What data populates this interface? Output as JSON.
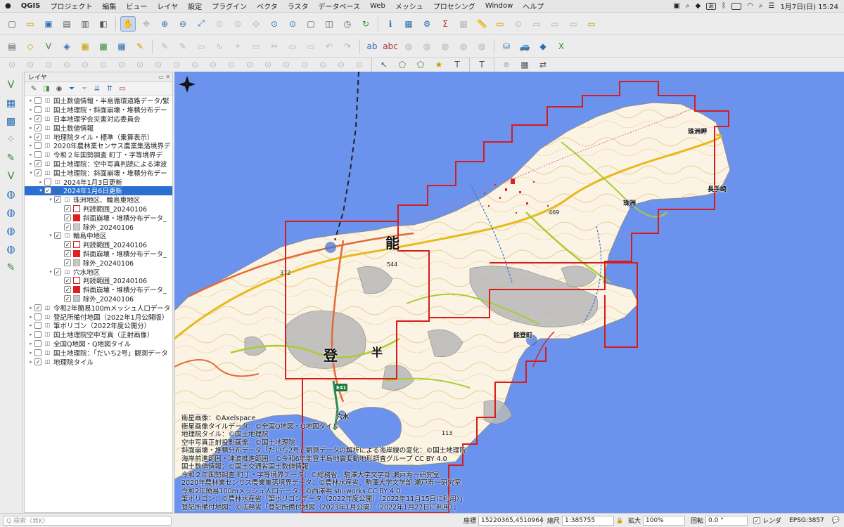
{
  "menubar": {
    "app": "QGIS",
    "items": [
      "プロジェクト",
      "編集",
      "ビュー",
      "レイヤ",
      "設定",
      "プラグイン",
      "ベクタ",
      "ラスタ",
      "データベース",
      "Web",
      "メッシュ",
      "プロセシング",
      "Window",
      "ヘルプ"
    ],
    "ime": "あ",
    "clock": "1月7日(日)  15:24"
  },
  "layers_panel": {
    "title": "レイヤ",
    "rows": [
      {
        "indent": 0,
        "arrow": "▸",
        "checked": false,
        "label": "国土数値情報・半島循環道路データ/緊"
      },
      {
        "indent": 0,
        "arrow": "▸",
        "checked": false,
        "label": "国土地理院・斜面崩壊・堆積分布デー"
      },
      {
        "indent": 0,
        "arrow": "▸",
        "checked": true,
        "label": "日本地理学会災害対応委員会"
      },
      {
        "indent": 0,
        "arrow": "▸",
        "checked": true,
        "label": "国土数値情報"
      },
      {
        "indent": 0,
        "arrow": "▸",
        "checked": true,
        "label": "地理院タイル・標準（乗算表示）"
      },
      {
        "indent": 0,
        "arrow": "▸",
        "checked": false,
        "label": "2020年農林業センサス農業集落境界デ"
      },
      {
        "indent": 0,
        "arrow": "▸",
        "checked": false,
        "label": "令和２年国勢調査 町丁・字等境界デ"
      },
      {
        "indent": 0,
        "arrow": "▸",
        "checked": true,
        "label": "国土地理院：空中写真判読による津波"
      },
      {
        "indent": 0,
        "arrow": "▾",
        "checked": true,
        "label": "国土地理院：斜面崩壊・堆積分布デー"
      },
      {
        "indent": 1,
        "arrow": "▸",
        "checked": false,
        "label": "2024年1月3日更新"
      },
      {
        "indent": 1,
        "arrow": "▾",
        "checked": true,
        "label": "2024年1月6日更新",
        "selected": true
      },
      {
        "indent": 2,
        "arrow": "▾",
        "checked": true,
        "label": "珠洲地区、輪島東地区"
      },
      {
        "indent": 3,
        "arrow": "",
        "checked": true,
        "label": "判読範囲_20240106",
        "swatch": "#ffffff",
        "swborder": "#cc2222"
      },
      {
        "indent": 3,
        "arrow": "",
        "checked": true,
        "label": "斜面崩壊・堆積分布データ_",
        "swatch": "#e02020",
        "swborder": "#e02020"
      },
      {
        "indent": 3,
        "arrow": "",
        "checked": true,
        "label": "除外_20240106",
        "swatch": "#c8c8c8",
        "swborder": "#aaaaaa"
      },
      {
        "indent": 2,
        "arrow": "▾",
        "checked": true,
        "label": "輪島中地区"
      },
      {
        "indent": 3,
        "arrow": "",
        "checked": true,
        "label": "判読範囲_20240106",
        "swatch": "#ffffff",
        "swborder": "#cc2222"
      },
      {
        "indent": 3,
        "arrow": "",
        "checked": true,
        "label": "斜面崩壊・堆積分布データ_",
        "swatch": "#e02020",
        "swborder": "#e02020"
      },
      {
        "indent": 3,
        "arrow": "",
        "checked": true,
        "label": "除外_20240106",
        "swatch": "#c8c8c8",
        "swborder": "#aaaaaa"
      },
      {
        "indent": 2,
        "arrow": "▾",
        "checked": true,
        "label": "穴水地区"
      },
      {
        "indent": 3,
        "arrow": "",
        "checked": true,
        "label": "判読範囲_20240106",
        "swatch": "#ffffff",
        "swborder": "#cc2222"
      },
      {
        "indent": 3,
        "arrow": "",
        "checked": true,
        "label": "斜面崩壊・堆積分布データ_",
        "swatch": "#e02020",
        "swborder": "#e02020"
      },
      {
        "indent": 3,
        "arrow": "",
        "checked": true,
        "label": "除外_20240106",
        "swatch": "#c8c8c8",
        "swborder": "#aaaaaa"
      },
      {
        "indent": 0,
        "arrow": "▸",
        "checked": true,
        "label": "令和2年簡易100mメッシュ人口データ"
      },
      {
        "indent": 0,
        "arrow": "▸",
        "checked": false,
        "label": "登記所備付地図（2022年1月公開版）"
      },
      {
        "indent": 0,
        "arrow": "▸",
        "checked": false,
        "label": "筆ポリゴン（2022年度公開分）"
      },
      {
        "indent": 0,
        "arrow": "▸",
        "checked": false,
        "label": "国土地理院空中写真（正射画像）"
      },
      {
        "indent": 0,
        "arrow": "▸",
        "checked": false,
        "label": "全国Q地図・Q地図タイル"
      },
      {
        "indent": 0,
        "arrow": "▸",
        "checked": false,
        "label": "国土地理院：「だいち2号」観測データ"
      },
      {
        "indent": 0,
        "arrow": "▸",
        "checked": true,
        "label": "地理院タイル"
      }
    ]
  },
  "map": {
    "place_labels": {
      "suzu_misaki": "珠洲岬",
      "nagate_misaki": "長手崎",
      "suzu": "珠洲",
      "noto_town": "能登町",
      "anamizu": "穴水"
    },
    "peninsula_chars": {
      "no": "能",
      "to": "登",
      "sub": "半"
    },
    "spot_heights": {
      "h469": "469",
      "h544": "544",
      "h372": "372",
      "h113": "113"
    },
    "route": "E41",
    "attribution": [
      "衛星画像：©Axelspace",
      "衛星画像タイルデータ：©全国Q地図・Q地図タイル",
      "地理院タイル：©国土地理院",
      "空中写真正射投影画像：©国土地理院",
      "斜面崩壊・堆積分布データ「だいち2号」観測データの解析による海岸線の変化：©国土地理院",
      "海岸前進範囲・津波推進範囲：©令和6年能登半島地震変動地形調査グループ CC BY 4.0",
      "国土数値情報：©国土交通省国土数値情報",
      "令和２年国勢調査 町丁・字等境界データ：©総務省、駒澤大学文学部 瀬戸寿一研究室",
      "2020年農林業センサス農業集落境界データ：©農林水産省、駒澤大学文学部 瀬戸寿一研究室",
      "令和2年簡易100mメッシュ人口データ：©西澤明 shi-works CC BY 4.0",
      "筆ポリゴン：©農林水産省「筆ポリゴンデータ（2022年度公開）（2022年11月15日に利用）」",
      "登記所備付地図：©法務省「登記所備付地図（2023年1月公開）（2022年1月27日に利用）」"
    ]
  },
  "statusbar": {
    "search_placeholder": "Q  検索（⌘K）",
    "coord_label": "座標",
    "coord_value": "15220365,4510964",
    "scale_label": "縮尺",
    "scale_value": "1:385755",
    "magnifier_label": "拡大",
    "magnifier_value": "100%",
    "rotation_label": "回転",
    "rotation_value": "0.0 °",
    "render_label": "レンダ",
    "render_checked": true,
    "crs": "EPSG:3857"
  }
}
